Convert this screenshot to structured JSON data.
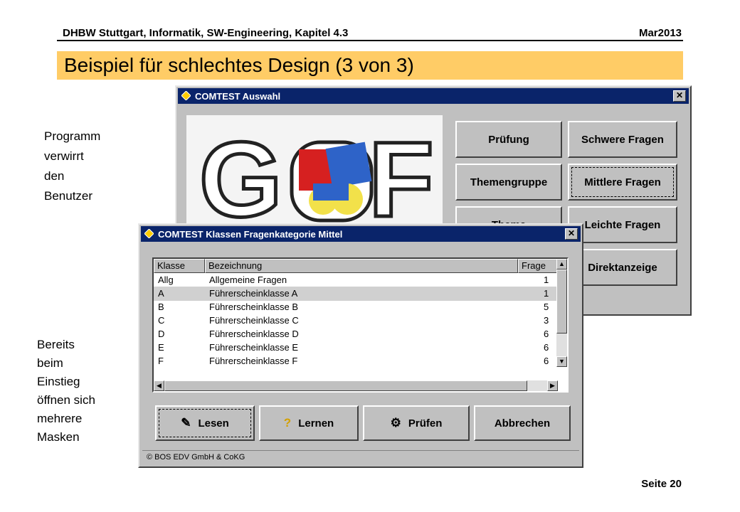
{
  "slide": {
    "header_left": "DHBW Stuttgart, Informatik, SW-Engineering, Kapitel 4.3",
    "header_right": "Mar2013",
    "title": "Beispiel für schlechtes Design (3 von 3)",
    "side_text_1": [
      "Programm",
      "verwirrt",
      "den",
      "Benutzer"
    ],
    "side_text_2": [
      "Bereits",
      "beim",
      "Einstieg",
      "öffnen sich",
      "mehrere",
      "Masken"
    ],
    "footer": "Seite 20"
  },
  "window_auswahl": {
    "title": "COMTEST Auswahl",
    "close": "✕",
    "logo_text": "GOF",
    "buttons": [
      "Prüfung",
      "Schwere Fragen",
      "Themengruppe",
      "Mittlere Fragen",
      "Thema",
      "Leichte Fragen",
      "Direktanzeige"
    ]
  },
  "window_klassen": {
    "title": "COMTEST Klassen  Fragenkategorie Mittel",
    "close": "✕",
    "columns": [
      "Klasse",
      "Bezeichnung",
      "Frage"
    ],
    "rows": [
      {
        "klasse": "Allg",
        "bezeichnung": "Allgemeine Fragen",
        "frage": "1"
      },
      {
        "klasse": "A",
        "bezeichnung": "Führerscheinklasse A",
        "frage": "1"
      },
      {
        "klasse": "B",
        "bezeichnung": "Führerscheinklasse B",
        "frage": "5"
      },
      {
        "klasse": "C",
        "bezeichnung": "Führerscheinklasse C",
        "frage": "3"
      },
      {
        "klasse": "D",
        "bezeichnung": "Führerscheinklasse D",
        "frage": "6"
      },
      {
        "klasse": "E",
        "bezeichnung": "Führerscheinklasse E",
        "frage": "6"
      },
      {
        "klasse": "F",
        "bezeichnung": "Führerscheinklasse F",
        "frage": "6"
      }
    ],
    "selected_row": 1,
    "buttons": {
      "lesen": "Lesen",
      "lernen": "Lernen",
      "pruefen": "Prüfen",
      "abbrechen": "Abbrechen"
    },
    "status": "© BOS EDV GmbH & CoKG"
  },
  "colors": {
    "title_band": "#ffcc66",
    "window_title": "#0a246a",
    "window_face": "#c0c0c0"
  }
}
